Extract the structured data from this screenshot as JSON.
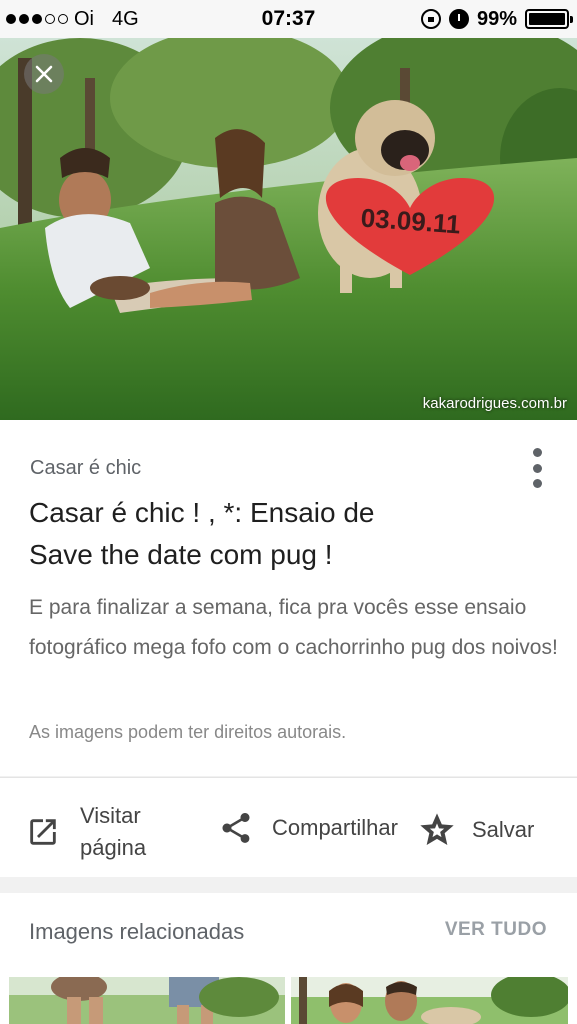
{
  "status_bar": {
    "carrier": "Oi",
    "network": "4G",
    "time": "07:37",
    "battery": "99%",
    "battery_level": 0.99
  },
  "hero": {
    "heart_date": "03.09.11",
    "watermark": "kakarodrigues.com.br",
    "close_icon": "close-icon"
  },
  "result": {
    "source": "Casar é chic",
    "title": "Casar é chic ! , *: Ensaio de Save the date com pug !",
    "description": "E para finalizar a semana, fica pra vocês esse ensaio fotográfico mega fofo com o cachorrinho pug dos noivos!",
    "copyright": "As imagens podem ter direitos autorais."
  },
  "actions": {
    "visit": "Visitar página",
    "share": "Compartilhar",
    "save": "Salvar"
  },
  "related": {
    "title": "Imagens relacionadas",
    "see_all": "VER TUDO"
  },
  "colors": {
    "grass": "#3f7c2c",
    "heart": "#e23b3b",
    "icon_gray": "#444444"
  }
}
